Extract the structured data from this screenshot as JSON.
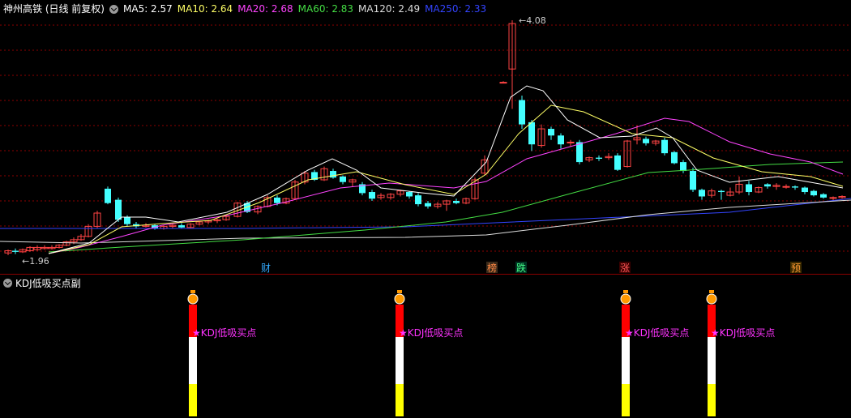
{
  "header": {
    "title": "神州高铁 (日线 前复权)",
    "ma": [
      {
        "label": "MA5: 2.57",
        "color": "#ffffff"
      },
      {
        "label": "MA10: 2.64",
        "color": "#ffff66"
      },
      {
        "label": "MA20: 2.68",
        "color": "#ff44ff"
      },
      {
        "label": "MA60: 2.83",
        "color": "#44dd44"
      },
      {
        "label": "MA120: 2.49",
        "color": "#dddddd"
      },
      {
        "label": "MA250: 2.33",
        "color": "#3344ff"
      }
    ]
  },
  "price": {
    "high_label": "4.08",
    "low_label": "1.96",
    "high_value": 4.08,
    "low_value": 1.96
  },
  "markers": [
    {
      "label": "财",
      "bg": "#000000",
      "fg": "#33aaff"
    },
    {
      "label": "榜",
      "bg": "#3a2a1a",
      "fg": "#ff8844"
    },
    {
      "label": "跌",
      "bg": "#003322",
      "fg": "#44ff88"
    },
    {
      "label": "涨",
      "bg": "#3a0000",
      "fg": "#ff5555"
    },
    {
      "label": "预",
      "bg": "#3a2a00",
      "fg": "#ff9933"
    }
  ],
  "sub_indicator": {
    "title": "KDJ低吸买点副",
    "signal_label": "★KDJ低吸买点",
    "signal_count": 4,
    "colors": {
      "top": "#ff0000",
      "mid": "#ffffff",
      "bottom": "#ffff00",
      "text": "#ff33ff"
    }
  },
  "colors": {
    "up": "#ff4444",
    "down": "#44ffff",
    "grid": "#8b0000"
  }
}
